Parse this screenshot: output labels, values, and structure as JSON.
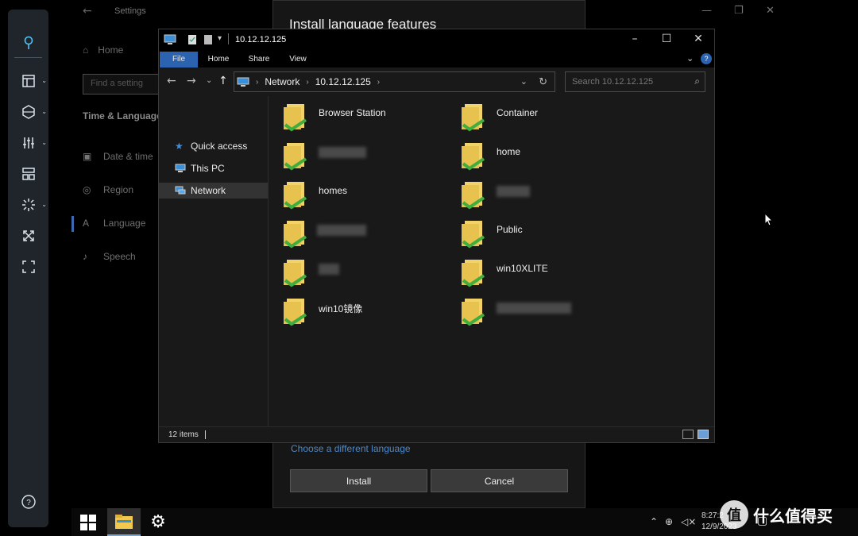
{
  "settings": {
    "window_title": "Settings",
    "home": "Home",
    "search_placeholder": "Find a setting",
    "section": "Time & Language",
    "items": [
      "Date & time",
      "Region",
      "Language",
      "Speech"
    ]
  },
  "dialog": {
    "title": "Install language features",
    "link": "Choose a different language",
    "install_button": "Install",
    "cancel_button": "Cancel"
  },
  "explorer": {
    "window_title": "10.12.12.125",
    "ribbon_tabs": [
      "File",
      "Home",
      "Share",
      "View"
    ],
    "breadcrumb": [
      "Network",
      "10.12.12.125"
    ],
    "search_placeholder": "Search 10.12.12.125",
    "nav_items": [
      "Quick access",
      "This PC",
      "Network"
    ],
    "folders": [
      "Browser Station",
      "Container",
      "",
      "home",
      "homes",
      "",
      "",
      "Public",
      "",
      "win10XLITE",
      "win10镜像",
      ""
    ],
    "status": "12 items"
  },
  "taskbar": {
    "time": "8:27:2",
    "date": "12/9/2023"
  },
  "watermark": {
    "logo_char": "值",
    "text": "什么值得买"
  },
  "colors": {
    "accent": "#2b63b0",
    "link": "#4e88c8",
    "folder": "#f2d36b",
    "share_arrow": "#3fae3f"
  }
}
